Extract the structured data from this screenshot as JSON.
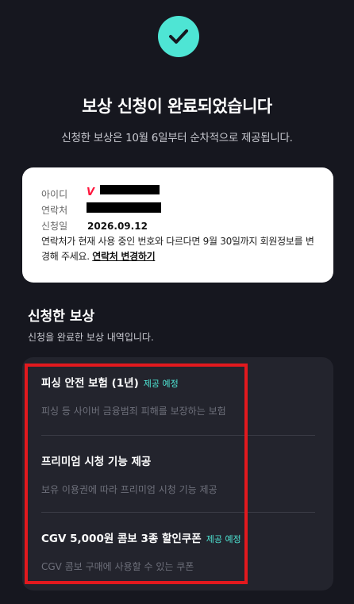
{
  "header": {
    "title": "보상 신청이 완료되었습니다",
    "subtitle": "신청한 보상은 10월 6일부터 순차적으로 제공됩니다."
  },
  "info": {
    "id_label": "아이디",
    "contact_label": "연락처",
    "date_label": "신청일",
    "date_value": "2026.09.12",
    "id_logo": "V",
    "notice_text": "연락처가 현재 사용 중인 번호와 다르다면 9월 30일까지 회원정보를 변경해 주세요. ",
    "change_link": "연락처 변경하기"
  },
  "rewards": {
    "title": "신청한 보상",
    "subtitle": "신청을 완료한 보상 내역입니다.",
    "items": [
      {
        "title": "피싱 안전 보험 (1년)",
        "badge": "제공 예정",
        "desc": "피싱 등 사이버 금융범죄 피해를 보장하는 보험"
      },
      {
        "title": "프리미엄 시청 기능 제공",
        "badge": "",
        "desc": "보유 이용권에 따라 프리미엄 시청 기능 제공"
      },
      {
        "title": "CGV 5,000원 콤보 3종 할인쿠폰",
        "badge": "제공 예정",
        "desc": "CGV 콤보 구매에 사용할 수 있는 쿠폰"
      }
    ]
  },
  "colors": {
    "accent": "#4ee5d4",
    "background": "#16171f",
    "highlight_box": "#e2191e"
  }
}
